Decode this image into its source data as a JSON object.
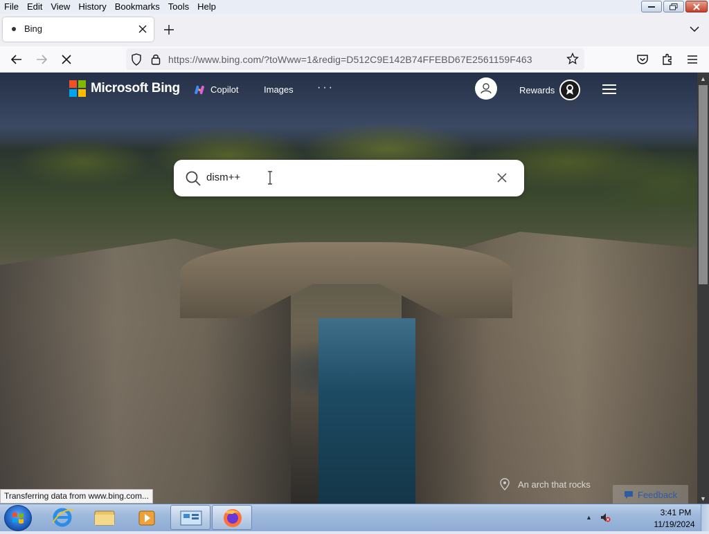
{
  "menubar": {
    "items": [
      "File",
      "Edit",
      "View",
      "History",
      "Bookmarks",
      "Tools",
      "Help"
    ]
  },
  "tab": {
    "title": "Bing"
  },
  "navbar": {
    "url": "https://www.bing.com/?toWww=1&redig=D512C9E142B74FFEBD67E2561159F463"
  },
  "bing": {
    "brand": "Microsoft Bing",
    "nav": {
      "copilot": "Copilot",
      "images": "Images",
      "more": "···"
    },
    "rewards": "Rewards",
    "search": {
      "query": "dism++"
    },
    "caption": "An arch that rocks",
    "feedback": "Feedback",
    "logo_colors": [
      "#f25022",
      "#7fba00",
      "#00a4ef",
      "#ffb900"
    ]
  },
  "status": {
    "text": "Transferring data from www.bing.com..."
  },
  "taskbar": {
    "apps": [
      "internet-explorer-icon",
      "file-explorer-icon",
      "media-player-icon",
      "control-panel-icon",
      "firefox-icon"
    ],
    "time": "3:41 PM",
    "date": "11/19/2024"
  }
}
